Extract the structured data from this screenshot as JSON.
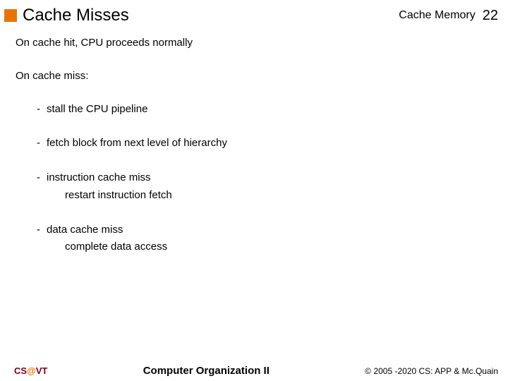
{
  "header": {
    "title": "Cache Misses",
    "subtitle": "Cache Memory",
    "page": "22"
  },
  "body": {
    "line_hit": "On cache hit, CPU proceeds normally",
    "line_miss": "On cache miss:",
    "items": {
      "stall": "stall the CPU pipeline",
      "fetch": "fetch block from next level of hierarchy",
      "icache": "instruction cache miss",
      "icache_sub": "restart instruction fetch",
      "dcache": "data cache miss",
      "dcache_sub": "complete data access"
    },
    "dash": "-"
  },
  "footer": {
    "cs": "CS",
    "at": "@",
    "vt": "VT",
    "center": "Computer Organization II",
    "right": "© 2005 -2020 CS: APP & Mc.Quain"
  }
}
